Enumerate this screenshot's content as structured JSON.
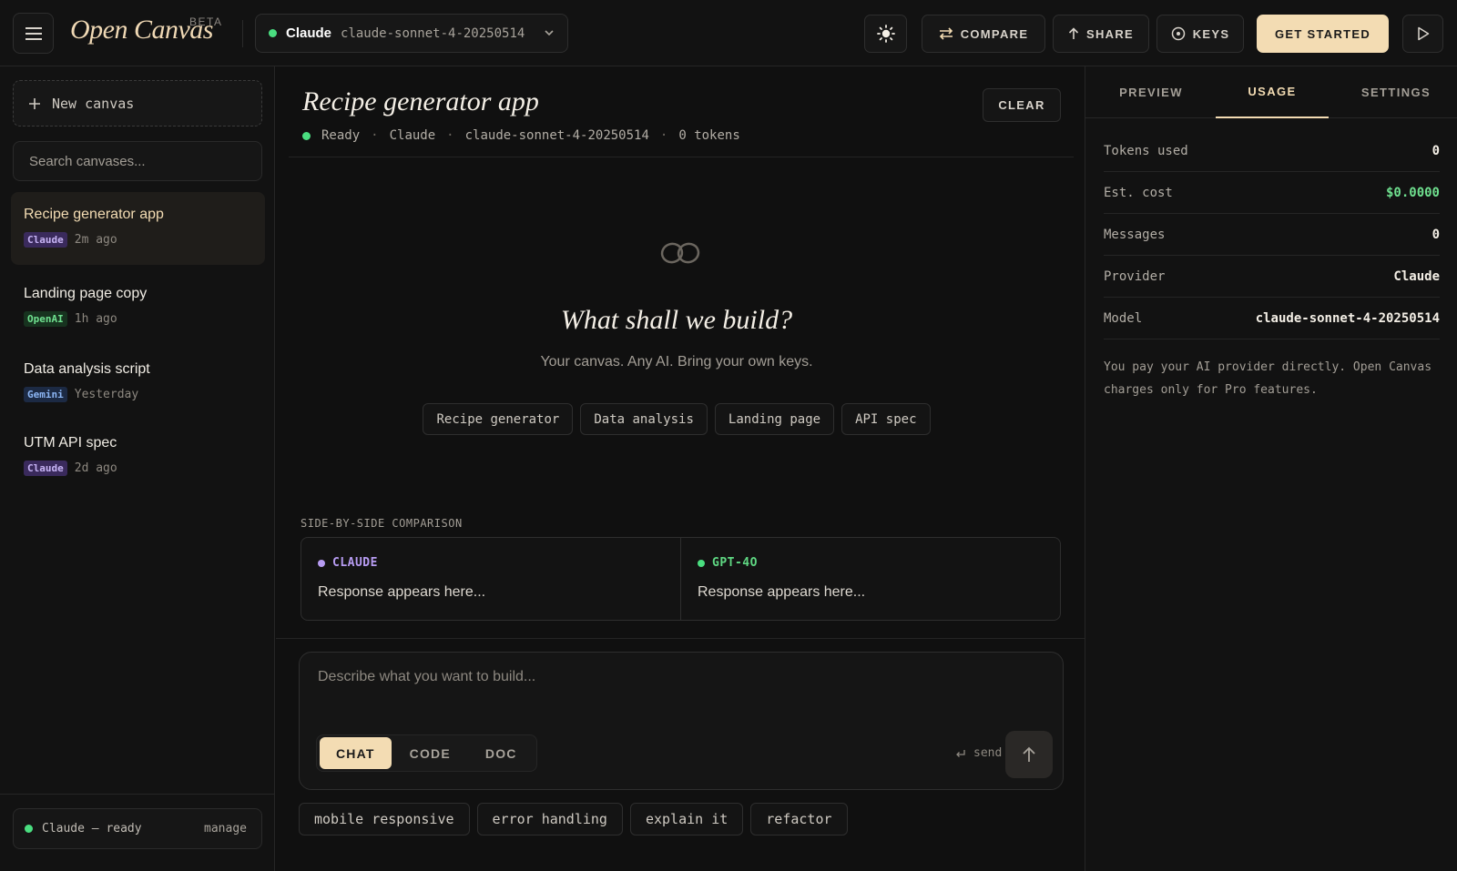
{
  "header": {
    "logo": "Open Canvas",
    "beta": "BETA",
    "provider": "Claude",
    "model": "claude-sonnet-4-20250514",
    "compare_label": "COMPARE",
    "share_label": "SHARE",
    "keys_label": "KEYS",
    "get_started_label": "GET STARTED"
  },
  "sidebar": {
    "new_canvas_label": "New canvas",
    "search_placeholder": "Search canvases...",
    "items": [
      {
        "title": "Recipe generator app",
        "provider": "Claude",
        "time": "2m ago"
      },
      {
        "title": "Landing page copy",
        "provider": "OpenAI",
        "time": "1h ago"
      },
      {
        "title": "Data analysis script",
        "provider": "Gemini",
        "time": "Yesterday"
      },
      {
        "title": "UTM API spec",
        "provider": "Claude",
        "time": "2d ago"
      }
    ],
    "footer_status": "Claude — ready",
    "footer_manage": "manage"
  },
  "main": {
    "title": "Recipe generator app",
    "clear_label": "CLEAR",
    "status": "Ready",
    "provider": "Claude",
    "model": "claude-sonnet-4-20250514",
    "tokens": "0 tokens",
    "empty_title": "What shall we build?",
    "empty_sub": "Your canvas. Any AI. Bring your own keys.",
    "suggestions": [
      "Recipe generator",
      "Data analysis",
      "Landing page",
      "API spec"
    ],
    "comparison_label": "SIDE-BY-SIDE COMPARISON",
    "comparison": [
      {
        "name": "CLAUDE",
        "text": "Response appears here..."
      },
      {
        "name": "GPT-4O",
        "text": "Response appears here..."
      }
    ],
    "composer_placeholder": "Describe what you want to build...",
    "modes": [
      "CHAT",
      "CODE",
      "DOC"
    ],
    "send_hint": "send",
    "chips": [
      "mobile responsive",
      "error handling",
      "explain it",
      "refactor"
    ]
  },
  "right_panel": {
    "tabs": [
      "PREVIEW",
      "USAGE",
      "SETTINGS"
    ],
    "stats": [
      {
        "key": "Tokens used",
        "value": "0"
      },
      {
        "key": "Est. cost",
        "value": "$0.0000"
      },
      {
        "key": "Messages",
        "value": "0"
      },
      {
        "key": "Provider",
        "value": "Claude"
      },
      {
        "key": "Model",
        "value": "claude-sonnet-4-20250514"
      }
    ],
    "note": "You pay your AI provider directly. Open Canvas charges only for Pro features."
  },
  "colors": {
    "accent": "#f3dcb3",
    "ready_green": "#4ade80",
    "claude_purple": "#b79cf2"
  }
}
